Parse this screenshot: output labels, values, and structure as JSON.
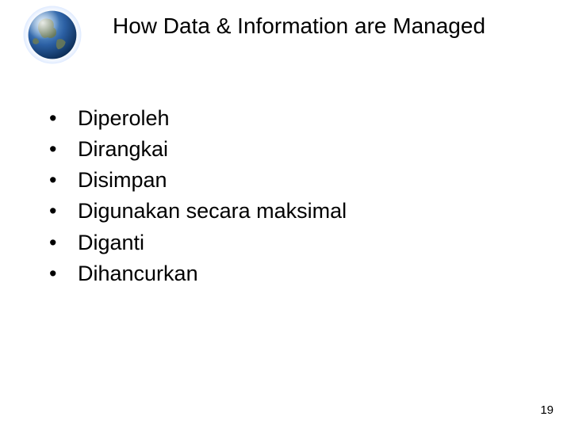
{
  "slide": {
    "title": "How Data & Information are Managed",
    "bullets": [
      "Diperoleh",
      "Dirangkai",
      "Disimpan",
      "Digunakan secara maksimal",
      "Diganti",
      "Dihancurkan"
    ],
    "page_number": "19",
    "icon": "globe-icon"
  }
}
